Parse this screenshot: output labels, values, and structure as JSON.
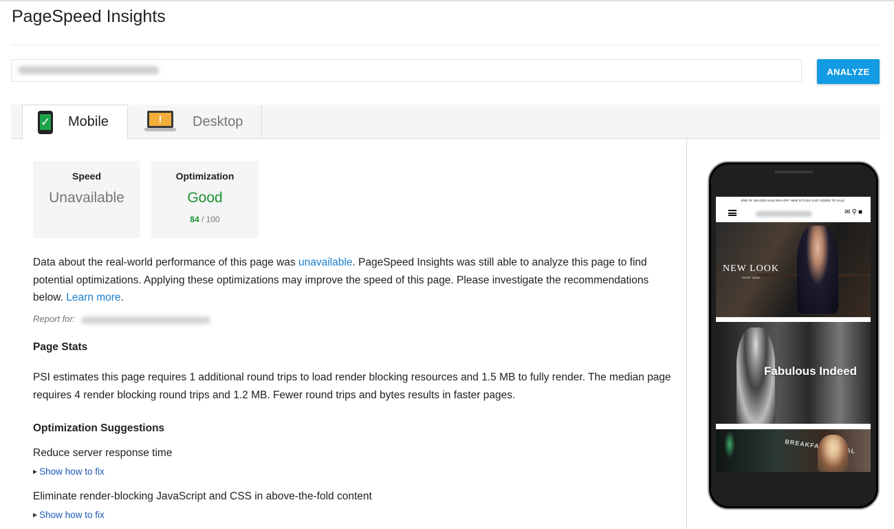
{
  "app": {
    "title": "PageSpeed Insights"
  },
  "search": {
    "url_value": "",
    "analyze_label": "ANALYZE"
  },
  "tabs": [
    {
      "label": "Mobile",
      "icon": "mobile-phone-check-icon",
      "active": true
    },
    {
      "label": "Desktop",
      "icon": "laptop-warning-icon",
      "active": false
    }
  ],
  "scores": {
    "speed": {
      "heading": "Speed",
      "value": "Unavailable"
    },
    "optimization": {
      "heading": "Optimization",
      "value": "Good",
      "score": "84",
      "max": "/ 100"
    }
  },
  "intro": {
    "text_1": "Data about the real-world performance of this page was ",
    "link_unavailable": "unavailable",
    "text_2": ". PageSpeed Insights was still able to analyze this page to find potential optimizations. Applying these optimizations may improve the speed of this page. Please investigate the recommendations below. ",
    "link_learn_more": "Learn more",
    "text_3": "."
  },
  "report_for_label": "Report for:",
  "page_stats": {
    "heading": "Page Stats",
    "text": "PSI estimates this page requires 1 additional round trips to load render blocking resources and 1.5 MB to fully render. The median page requires 4 render blocking round trips and 1.2 MB. Fewer round trips and bytes results in faster pages."
  },
  "suggestions": {
    "heading": "Optimization Suggestions",
    "items": [
      {
        "title": "Reduce server response time",
        "action": "Show how to fix"
      },
      {
        "title": "Eliminate render-blocking JavaScript and CSS in above-the-fold content",
        "action": "Show how to fix"
      }
    ]
  },
  "preview": {
    "promo_text": "END OF SEASON SALE 50% OFF. NEW STYLES JUST ADDED TO SALE.",
    "hero1_brand": "NEW LOOK",
    "hero1_cta": "SHOP NOW",
    "hero2_text": "Fabulous Indeed",
    "hero3_sign": "BREAKFA CENTRAL"
  },
  "colors": {
    "accent": "#129ae2",
    "good": "#1a9130",
    "link": "#1a7fce",
    "warning": "#f3ae3a"
  }
}
